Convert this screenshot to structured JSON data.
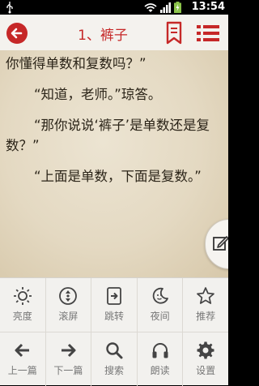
{
  "status_bar": {
    "time": "13:54"
  },
  "header": {
    "title": "1、裤子"
  },
  "content": {
    "paragraphs": [
      "你懂得单数和复数吗？”",
      "“知道，老师。”琼答。",
      "“那你说说‘裤子’是单数还是复数？”",
      "“上面是单数，下面是复数。”"
    ]
  },
  "toolbar": {
    "row1": [
      {
        "label": "亮度",
        "icon": "brightness-icon"
      },
      {
        "label": "滚屏",
        "icon": "scroll-icon"
      },
      {
        "label": "跳转",
        "icon": "jump-icon"
      },
      {
        "label": "夜间",
        "icon": "night-icon"
      },
      {
        "label": "推荐",
        "icon": "star-icon"
      }
    ],
    "row2": [
      {
        "label": "上一篇",
        "icon": "arrow-left-icon"
      },
      {
        "label": "下一篇",
        "icon": "arrow-right-icon"
      },
      {
        "label": "搜索",
        "icon": "search-icon"
      },
      {
        "label": "朗读",
        "icon": "headphones-icon"
      },
      {
        "label": "设置",
        "icon": "gear-icon"
      }
    ]
  },
  "colors": {
    "accent": "#c62828",
    "page_bg": "#e4d9c2",
    "toolbar_bg": "#f2f1ee"
  }
}
